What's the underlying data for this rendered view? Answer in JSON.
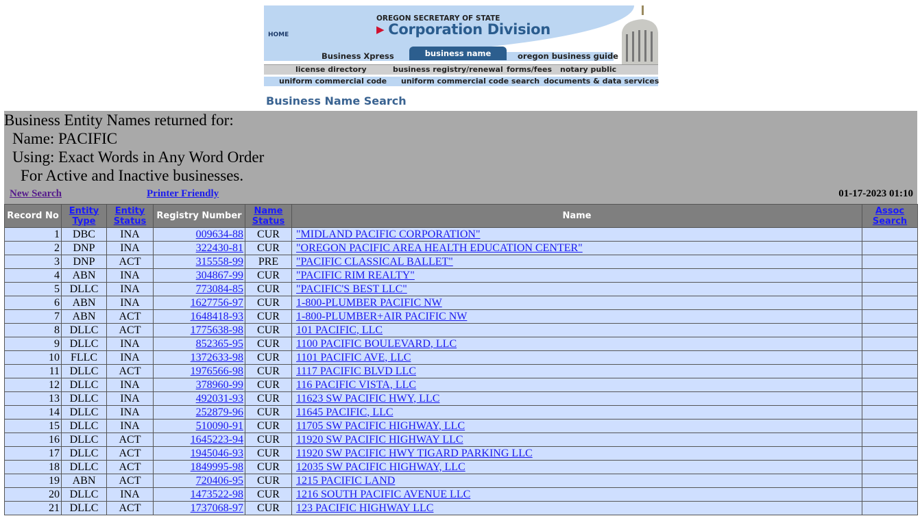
{
  "banner": {
    "home": "HOME",
    "agency": "OREGON SECRETARY OF STATE",
    "division": "Corporation Division",
    "tabs": [
      "Business Xpress",
      "business name search",
      "oregon business guide"
    ],
    "nav1": [
      "license directory",
      "business registry/renewal",
      "forms/fees",
      "notary public"
    ],
    "nav2": [
      "uniform commercial code",
      "uniform commercial code search",
      "documents & data services"
    ]
  },
  "page_title": "Business Name Search",
  "criteria": {
    "line1": "Business Entity Names returned for:",
    "line2": "Name: PACIFIC",
    "line3": "Using: Exact Words in Any Word Order",
    "line4": "For Active and Inactive businesses."
  },
  "links": {
    "new_search": "New Search",
    "printer_friendly": "Printer Friendly"
  },
  "datetime": "01-17-2023 01:10",
  "colors": {
    "row_bg": "#cfdfff",
    "header_bg": "#7f7f7f",
    "panel_bg": "#a9a9a9",
    "link": "#1a1aee",
    "visited": "#551a8b"
  },
  "table": {
    "headers": {
      "record_no": "Record No",
      "entity_type_1": "Entity",
      "entity_type_2": "Type",
      "entity_status_1": "Entity",
      "entity_status_2": "Status",
      "registry_number": "Registry Number",
      "name_status_1": "Name",
      "name_status_2": "Status",
      "name": "Name",
      "assoc_1": "Assoc",
      "assoc_2": "Search"
    },
    "rows": [
      [
        "1",
        "DBC",
        "INA",
        "009634-88",
        "CUR",
        "\"MIDLAND PACIFIC CORPORATION\""
      ],
      [
        "2",
        "DNP",
        "INA",
        "322430-81",
        "CUR",
        "\"OREGON PACIFIC AREA HEALTH EDUCATION CENTER\""
      ],
      [
        "3",
        "DNP",
        "ACT",
        "315558-99",
        "PRE",
        "\"PACIFIC CLASSICAL BALLET\""
      ],
      [
        "4",
        "ABN",
        "INA",
        "304867-99",
        "CUR",
        "\"PACIFIC RIM REALTY\""
      ],
      [
        "5",
        "DLLC",
        "INA",
        "773084-85",
        "CUR",
        "\"PACIFIC'S BEST LLC\""
      ],
      [
        "6",
        "ABN",
        "INA",
        "1627756-97",
        "CUR",
        "1-800-PLUMBER PACIFIC NW"
      ],
      [
        "7",
        "ABN",
        "ACT",
        "1648418-93",
        "CUR",
        "1-800-PLUMBER+AIR PACIFIC NW"
      ],
      [
        "8",
        "DLLC",
        "ACT",
        "1775638-98",
        "CUR",
        "101 PACIFIC, LLC"
      ],
      [
        "9",
        "DLLC",
        "INA",
        "852365-95",
        "CUR",
        "1100 PACIFIC BOULEVARD, LLC"
      ],
      [
        "10",
        "FLLC",
        "INA",
        "1372633-98",
        "CUR",
        "1101 PACIFIC AVE, LLC"
      ],
      [
        "11",
        "DLLC",
        "ACT",
        "1976566-98",
        "CUR",
        "1117 PACIFIC BLVD LLC"
      ],
      [
        "12",
        "DLLC",
        "INA",
        "378960-99",
        "CUR",
        "116 PACIFIC VISTA, LLC"
      ],
      [
        "13",
        "DLLC",
        "INA",
        "492031-93",
        "CUR",
        "11623 SW PACIFIC HWY, LLC"
      ],
      [
        "14",
        "DLLC",
        "INA",
        "252879-96",
        "CUR",
        "11645 PACIFIC, LLC"
      ],
      [
        "15",
        "DLLC",
        "INA",
        "510090-91",
        "CUR",
        "11705 SW PACIFIC HIGHWAY, LLC"
      ],
      [
        "16",
        "DLLC",
        "ACT",
        "1645223-94",
        "CUR",
        "11920 SW PACIFIC HIGHWAY LLC"
      ],
      [
        "17",
        "DLLC",
        "ACT",
        "1945046-93",
        "CUR",
        "11920 SW PACIFIC HWY TIGARD PARKING LLC"
      ],
      [
        "18",
        "DLLC",
        "ACT",
        "1849995-98",
        "CUR",
        "12035 SW PACIFIC HIGHWAY, LLC"
      ],
      [
        "19",
        "ABN",
        "ACT",
        "720406-95",
        "CUR",
        "1215 PACIFIC LAND"
      ],
      [
        "20",
        "DLLC",
        "INA",
        "1473522-98",
        "CUR",
        "1216 SOUTH PACIFIC AVENUE LLC"
      ],
      [
        "21",
        "DLLC",
        "ACT",
        "1737068-97",
        "CUR",
        "123 PACIFIC HIGHWAY LLC"
      ]
    ]
  }
}
